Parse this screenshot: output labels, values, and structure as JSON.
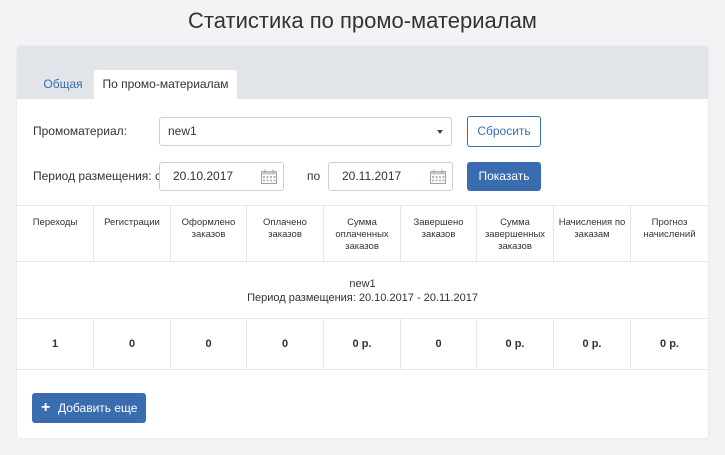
{
  "page": {
    "title": "Статистика по промо-материалам"
  },
  "tabs": [
    {
      "label": "Общая",
      "active": false
    },
    {
      "label": "По промо-материалам",
      "active": true
    }
  ],
  "form": {
    "promo_label": "Промоматериал:",
    "promo_value": "new1",
    "reset_label": "Сбросить",
    "period_label": "Период размещения: с",
    "date_from": "20.10.2017",
    "to_label": "по",
    "date_to": "20.11.2017",
    "show_label": "Показать"
  },
  "table": {
    "headers": [
      [
        "Переходы"
      ],
      [
        "Регистрации"
      ],
      [
        "Оформлено",
        "заказов"
      ],
      [
        "Оплачено",
        "заказов"
      ],
      [
        "Сумма",
        "оплаченных",
        "заказов"
      ],
      [
        "Завершено",
        "заказов"
      ],
      [
        "Сумма",
        "завершенных",
        "заказов"
      ],
      [
        "Начисления по",
        "заказам"
      ],
      [
        "Прогноз",
        "начислений"
      ]
    ],
    "group_name": "new1",
    "group_period": "Период размещения: 20.10.2017 - 20.11.2017",
    "row": [
      "1",
      "0",
      "0",
      "0",
      "0 р.",
      "0",
      "0 р.",
      "0 р.",
      "0 р."
    ]
  },
  "add_button": {
    "label": "Добавить еще"
  },
  "colors": {
    "accent": "#3a6cb0",
    "tabbar": "#e1e4e8",
    "background": "#f2f3f5"
  }
}
